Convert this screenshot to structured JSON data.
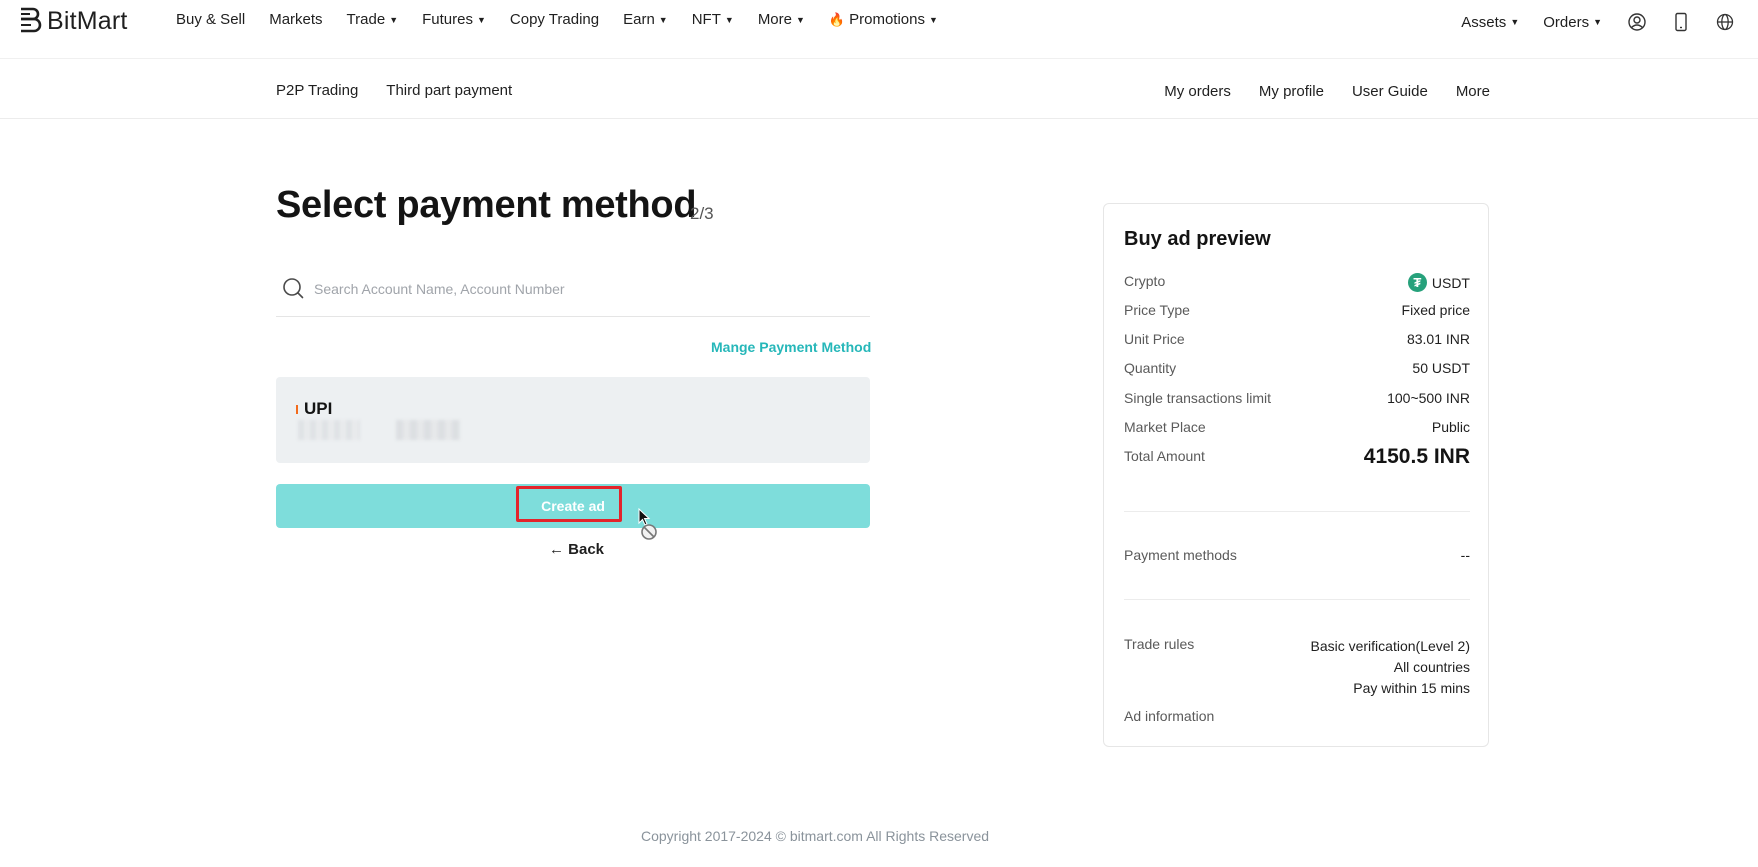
{
  "nav": {
    "brand": "BitMart",
    "links": [
      {
        "label": "Buy & Sell",
        "caret": false
      },
      {
        "label": "Markets",
        "caret": false
      },
      {
        "label": "Trade",
        "caret": true
      },
      {
        "label": "Futures",
        "caret": true
      },
      {
        "label": "Copy Trading",
        "caret": false
      },
      {
        "label": "Earn",
        "caret": true
      },
      {
        "label": "NFT",
        "caret": true
      },
      {
        "label": "More",
        "caret": true
      },
      {
        "label": "Promotions",
        "caret": true
      }
    ],
    "right": {
      "assets": "Assets",
      "orders": "Orders"
    }
  },
  "subnav": {
    "left": [
      "P2P Trading",
      "Third part payment"
    ],
    "right": [
      "My orders",
      "My profile",
      "User Guide",
      "More"
    ]
  },
  "main": {
    "title": "Select payment method",
    "step": "2/3",
    "search_placeholder": "Search Account Name, Account Number",
    "manage_link": "Mange Payment Method",
    "payment_method": {
      "name": "UPI"
    },
    "create_button": "Create ad",
    "back_link": "← Back"
  },
  "preview": {
    "title": "Buy ad preview",
    "rows": [
      {
        "key": "Crypto",
        "value": "USDT"
      },
      {
        "key": "Price Type",
        "value": "Fixed price"
      },
      {
        "key": "Unit Price",
        "value": "83.01 INR"
      },
      {
        "key": "Quantity",
        "value": "50 USDT"
      },
      {
        "key": "Single transactions limit",
        "value": "100~500 INR"
      },
      {
        "key": "Market Place",
        "value": "Public"
      },
      {
        "key": "Total Amount",
        "value": "4150.5 INR"
      }
    ],
    "payment_methods": {
      "key": "Payment methods",
      "value": "--"
    },
    "trade_rules": {
      "key": "Trade rules",
      "lines": [
        "Basic verification(Level 2)",
        "All countries",
        "Pay within 15 mins"
      ]
    },
    "ad_information": "Ad information"
  },
  "footer": {
    "copyright": "Copyright 2017-2024 © bitmart.com All Rights Reserved"
  },
  "colors": {
    "accent": "#26b7b9",
    "button": "#7edddb",
    "highlight": "#e3242b",
    "tether": "#26a17b"
  }
}
